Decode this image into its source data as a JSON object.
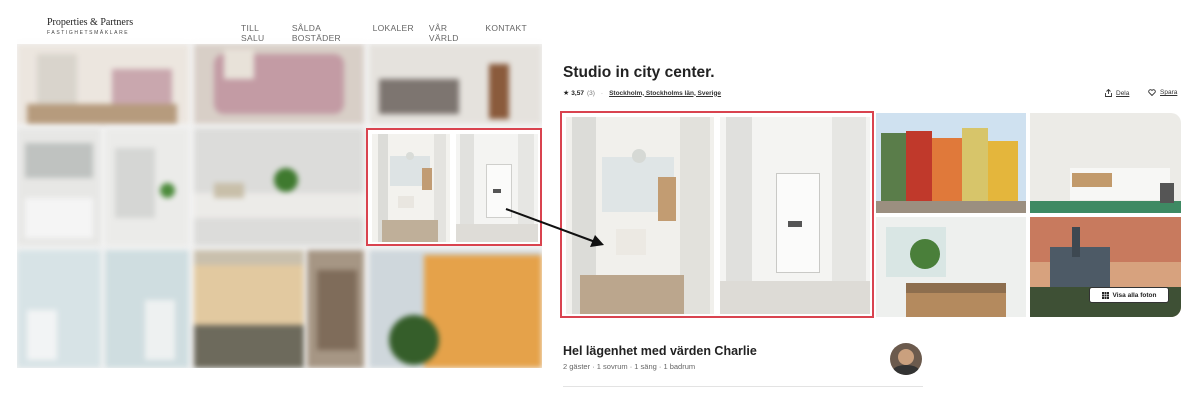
{
  "left_site": {
    "logo_name": "Properties & Partners",
    "logo_sub": "FASTIGHETSMÄKLARE",
    "nav": [
      "TILL SALU",
      "SÅLDA BOSTÄDER",
      "LOKALER",
      "VÅR VÄRLD",
      "KONTAKT"
    ]
  },
  "listing": {
    "title": "Studio in city center.",
    "rating": "3,57",
    "review_count": "(3)",
    "location": "Stockholm, Stockholms län, Sverige",
    "share_label": "Dela",
    "save_label": "Spara",
    "show_all_label": "Visa alla foton",
    "host_title": "Hel lägenhet med värden Charlie",
    "host_details": "2 gäster · 1 sovrum · 1 säng · 1 badrum"
  },
  "colors": {
    "highlight": "#d9434f",
    "accent_pink": "#e91e63"
  },
  "icons": [
    "star-icon",
    "share-icon",
    "heart-icon",
    "grid-icon",
    "arrow-icon"
  ]
}
